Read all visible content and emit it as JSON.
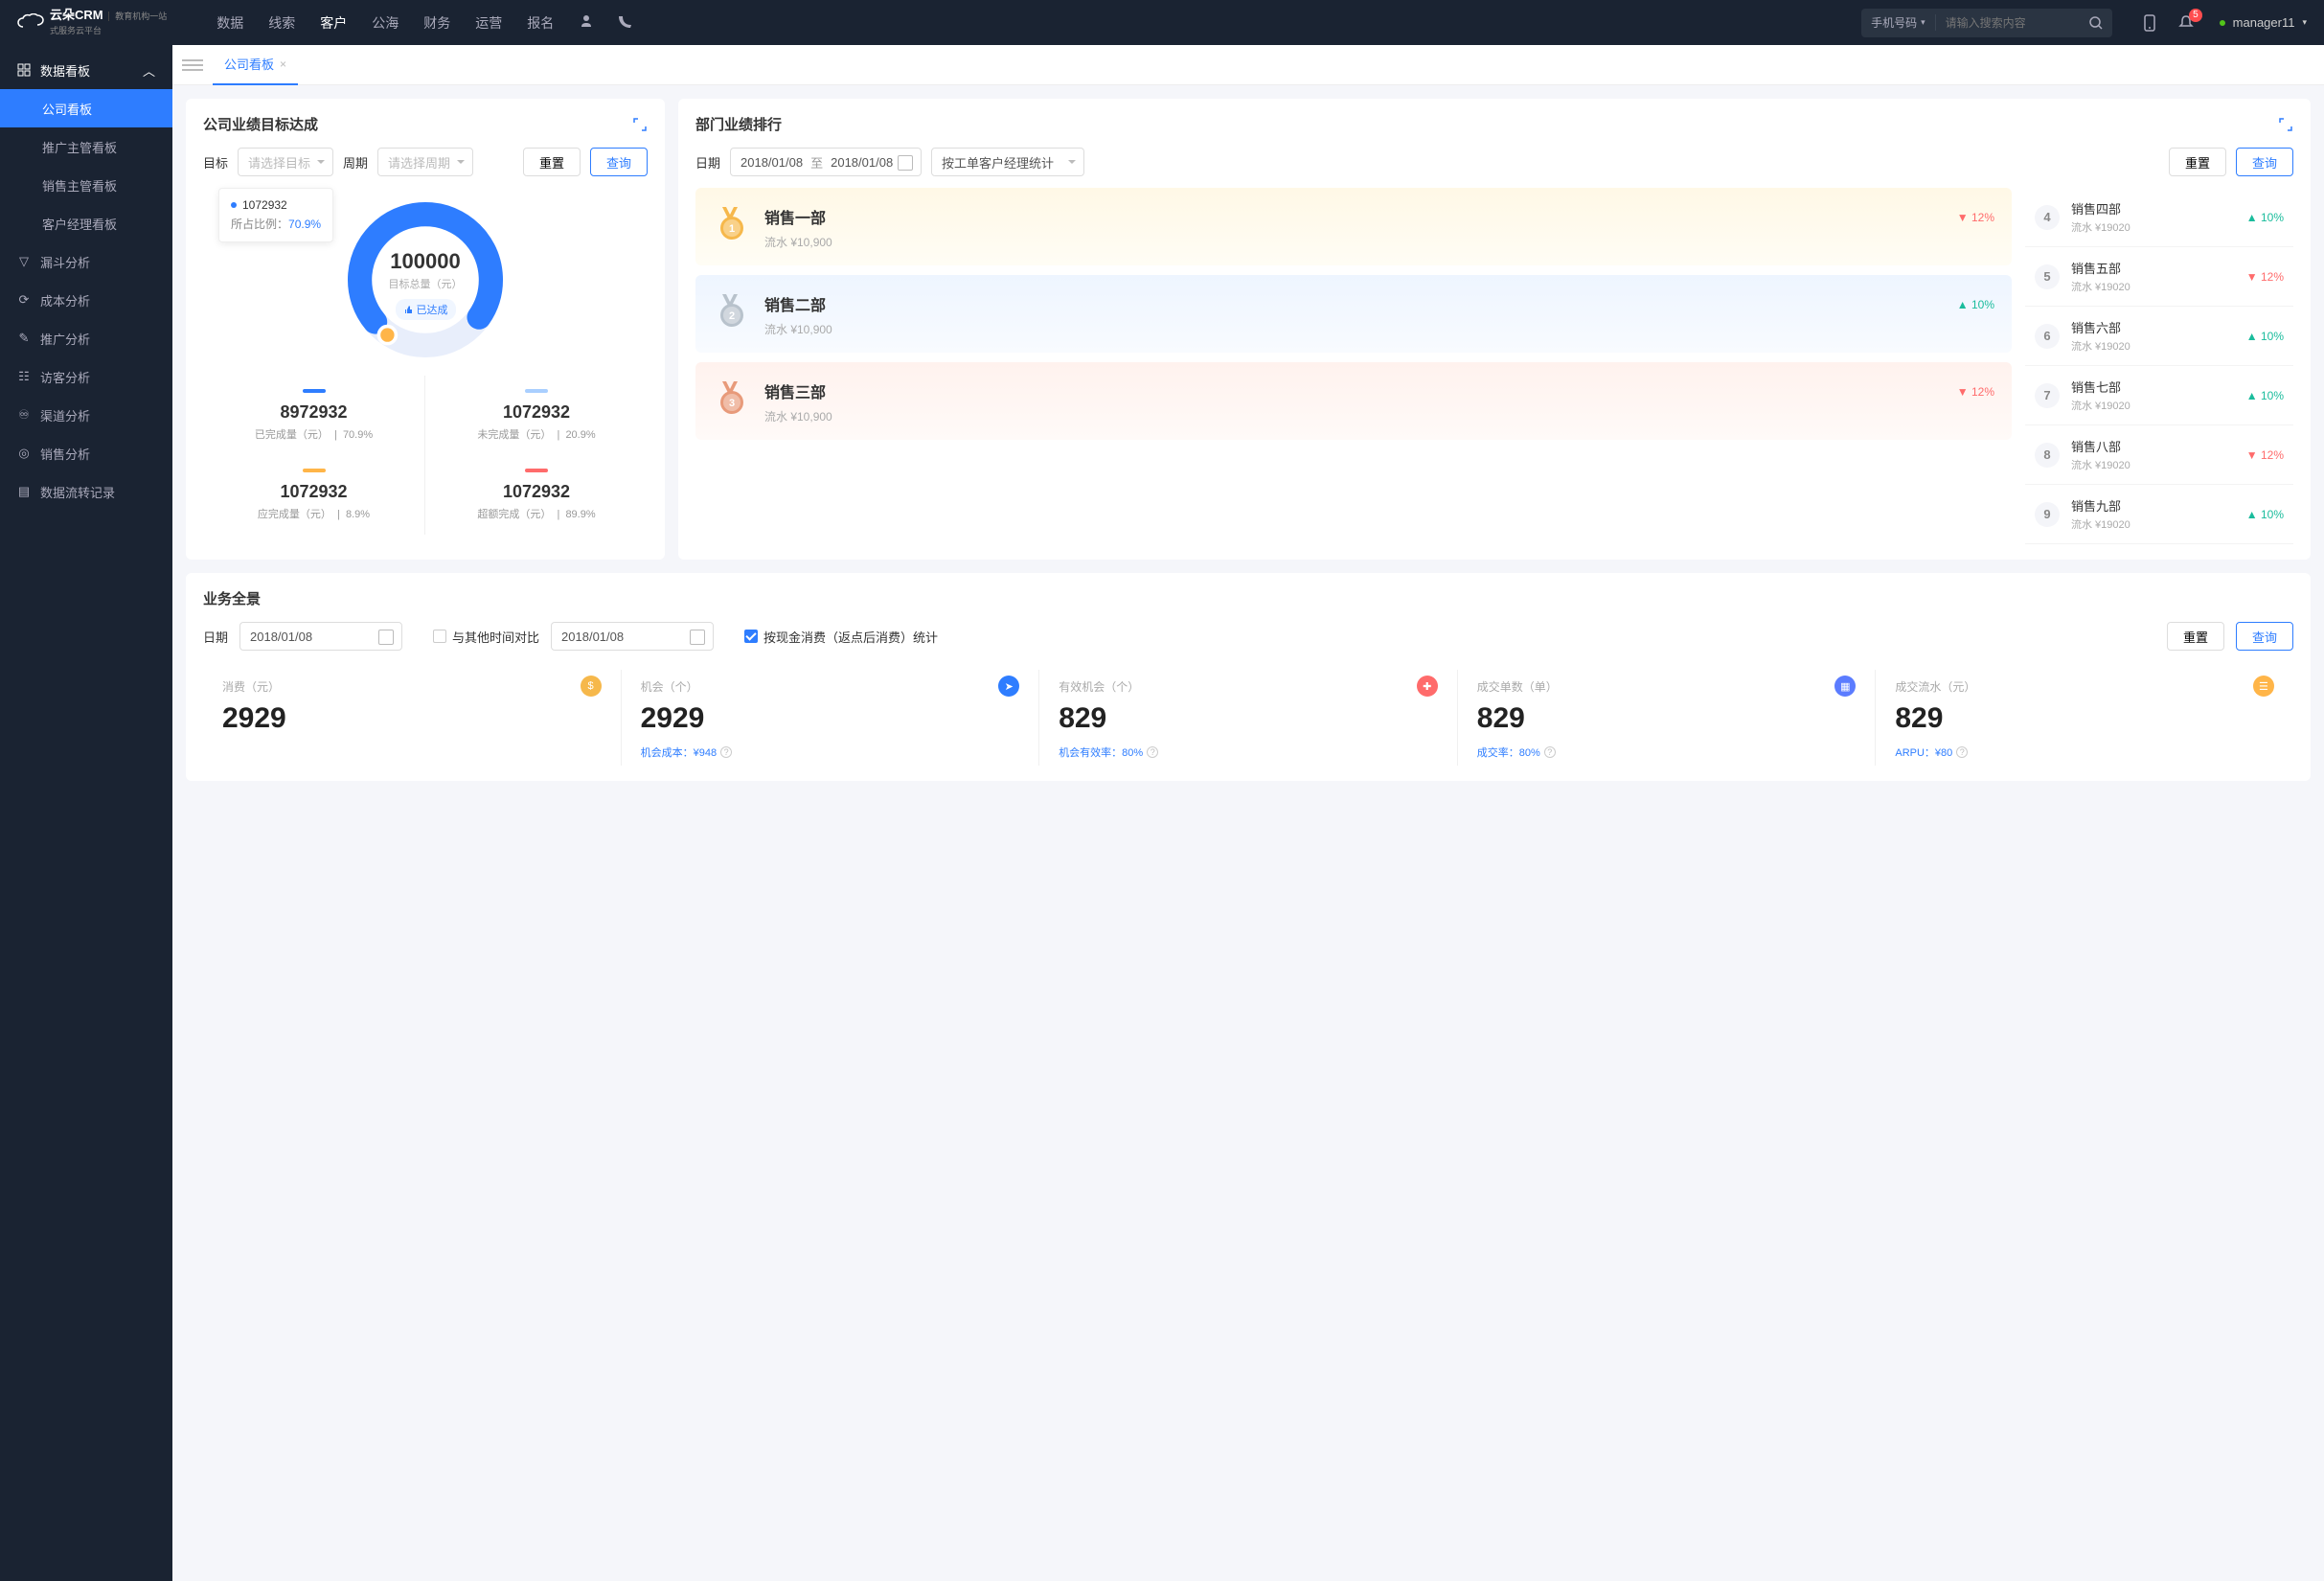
{
  "brand": {
    "name": "云朵CRM",
    "tag1": "教育机构一站",
    "tag2": "式服务云平台"
  },
  "topnav": [
    "数据",
    "线索",
    "客户",
    "公海",
    "财务",
    "运营",
    "报名"
  ],
  "topnav_active": 2,
  "search": {
    "type": "手机号码",
    "placeholder": "请输入搜索内容"
  },
  "notif_count": "5",
  "user": "manager11",
  "sidebar": {
    "group": "数据看板",
    "subs": [
      "公司看板",
      "推广主管看板",
      "销售主管看板",
      "客户经理看板"
    ],
    "active_sub": 0,
    "items": [
      "漏斗分析",
      "成本分析",
      "推广分析",
      "访客分析",
      "渠道分析",
      "销售分析",
      "数据流转记录"
    ]
  },
  "tab": {
    "label": "公司看板"
  },
  "goal_card": {
    "title": "公司业绩目标达成",
    "target_lbl": "目标",
    "target_ph": "请选择目标",
    "period_lbl": "周期",
    "period_ph": "请选择周期",
    "reset": "重置",
    "query": "查询",
    "center_value": "100000",
    "center_sub": "目标总量（元）",
    "tag": "已达成",
    "tooltip_value": "1072932",
    "tooltip_ratio_lbl": "所占比例：",
    "tooltip_ratio": "70.9%",
    "stats": [
      {
        "color": "#2e7dff",
        "value": "8972932",
        "label": "已完成量（元）",
        "pct": "70.9%"
      },
      {
        "color": "#a9cfff",
        "value": "1072932",
        "label": "未完成量（元）",
        "pct": "20.9%"
      },
      {
        "color": "#ffb548",
        "value": "1072932",
        "label": "应完成量（元）",
        "pct": "8.9%"
      },
      {
        "color": "#ff6b6b",
        "value": "1072932",
        "label": "超额完成（元）",
        "pct": "89.9%"
      }
    ]
  },
  "rank_card": {
    "title": "部门业绩排行",
    "date_lbl": "日期",
    "date_from": "2018/01/08",
    "to": "至",
    "date_to": "2018/01/08",
    "mode": "按工单客户经理统计",
    "reset": "重置",
    "query": "查询",
    "podium": [
      {
        "rank": "1",
        "name": "销售一部",
        "rev": "流水 ¥10,900",
        "pct": "12%",
        "dir": "down"
      },
      {
        "rank": "2",
        "name": "销售二部",
        "rev": "流水 ¥10,900",
        "pct": "10%",
        "dir": "up"
      },
      {
        "rank": "3",
        "name": "销售三部",
        "rev": "流水 ¥10,900",
        "pct": "12%",
        "dir": "down"
      }
    ],
    "list": [
      {
        "rank": "4",
        "name": "销售四部",
        "rev": "流水 ¥19020",
        "pct": "10%",
        "dir": "up"
      },
      {
        "rank": "5",
        "name": "销售五部",
        "rev": "流水 ¥19020",
        "pct": "12%",
        "dir": "down"
      },
      {
        "rank": "6",
        "name": "销售六部",
        "rev": "流水 ¥19020",
        "pct": "10%",
        "dir": "up"
      },
      {
        "rank": "7",
        "name": "销售七部",
        "rev": "流水 ¥19020",
        "pct": "10%",
        "dir": "up"
      },
      {
        "rank": "8",
        "name": "销售八部",
        "rev": "流水 ¥19020",
        "pct": "12%",
        "dir": "down"
      },
      {
        "rank": "9",
        "name": "销售九部",
        "rev": "流水 ¥19020",
        "pct": "10%",
        "dir": "up"
      }
    ]
  },
  "overview": {
    "title": "业务全景",
    "date_lbl": "日期",
    "date1": "2018/01/08",
    "cmp_lbl": "与其他时间对比",
    "date2": "2018/01/08",
    "stat_lbl": "按现金消费（返点后消费）统计",
    "reset": "重置",
    "query": "查询",
    "metrics": [
      {
        "name": "消费（元）",
        "value": "2929",
        "foot": "",
        "icon": "#f6b84b"
      },
      {
        "name": "机会（个）",
        "value": "2929",
        "foot": "机会成本：¥948",
        "icon": "#2e7dff"
      },
      {
        "name": "有效机会（个）",
        "value": "829",
        "foot": "机会有效率：80%",
        "icon": "#ff6b6b"
      },
      {
        "name": "成交单数（单）",
        "value": "829",
        "foot": "成交率：80%",
        "icon": "#5b7cff"
      },
      {
        "name": "成交流水（元）",
        "value": "829",
        "foot": "ARPU：¥80",
        "icon": "#ffb548"
      }
    ]
  }
}
